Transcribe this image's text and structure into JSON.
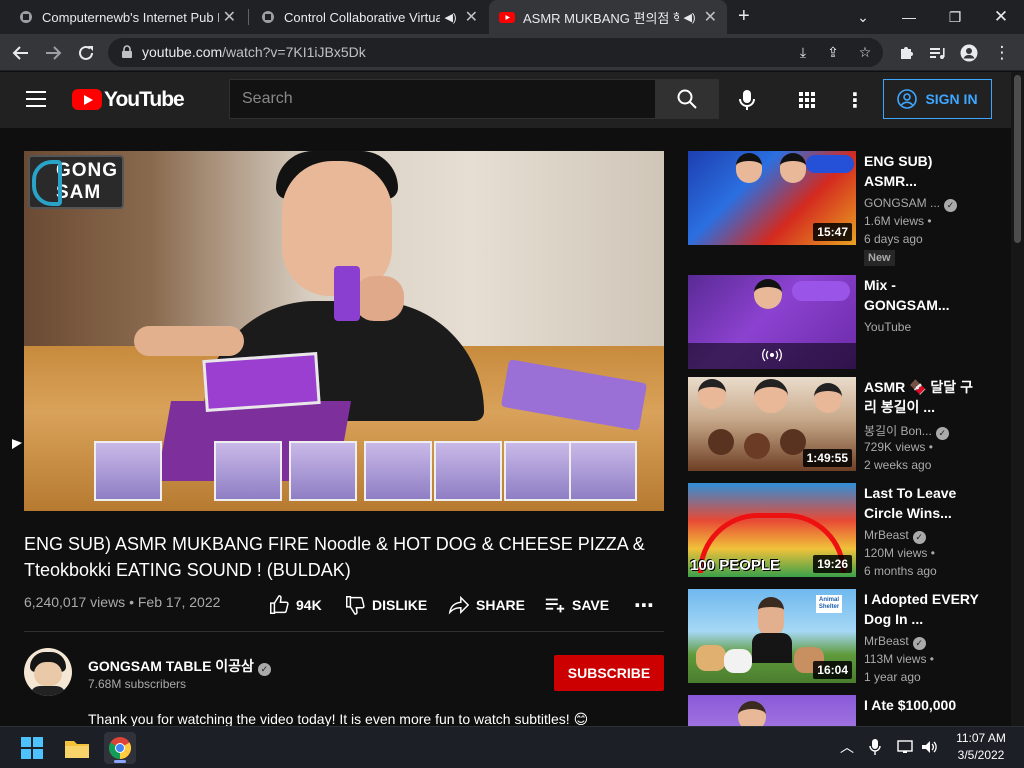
{
  "browser": {
    "tabs": [
      {
        "title": "Computernewb's Internet Pub H",
        "active": false
      },
      {
        "title": "Control Collaborative Virtual",
        "active": false
      },
      {
        "title": "ASMR MUKBANG 편의점 핵",
        "active": true
      }
    ],
    "url_domain": "youtube.com",
    "url_path": "/watch?v=7KI1iJBx5Dk"
  },
  "youtube": {
    "logo_text": "YouTube",
    "search_placeholder": "Search",
    "sign_in_label": "SIGN IN"
  },
  "video": {
    "overlay_logo": "GONG SAM",
    "title": "ENG SUB) ASMR MUKBANG FIRE Noodle & HOT DOG & CHEESE PIZZA & Tteokbokki EATING SOUND ! (BULDAK)",
    "views": "6,240,017 views",
    "date": "Feb 17, 2022",
    "likes": "94K",
    "dislike_label": "DISLIKE",
    "share_label": "SHARE",
    "save_label": "SAVE"
  },
  "channel": {
    "name": "GONGSAM TABLE 이공삼",
    "subscribers": "7.68M subscribers",
    "subscribe_label": "SUBSCRIBE",
    "description_line": "Thank you for watching the video today! It is even more fun to watch subtitles!"
  },
  "recommendations": [
    {
      "title": "ENG SUB) ASMR...",
      "channel": "GONGSAM ...",
      "verified": true,
      "views": "1.6M views",
      "age": "6 days ago",
      "duration": "15:47",
      "badge": "New"
    },
    {
      "title": "Mix - GONGSAM...",
      "channel": "YouTube",
      "verified": false,
      "views": "",
      "age": "",
      "duration": "",
      "badge": ""
    },
    {
      "title": "ASMR 🍫 달달 구리 봉길이 ...",
      "channel": "봉길이 Bon...",
      "verified": true,
      "views": "729K views",
      "age": "2 weeks ago",
      "duration": "1:49:55",
      "badge": ""
    },
    {
      "title": "Last To Leave Circle Wins...",
      "channel": "MrBeast",
      "verified": true,
      "views": "120M views",
      "age": "6 months ago",
      "duration": "19:26",
      "badge": ""
    },
    {
      "title": "I Adopted EVERY Dog In ...",
      "channel": "MrBeast",
      "verified": true,
      "views": "113M views",
      "age": "1 year ago",
      "duration": "16:04",
      "badge": ""
    },
    {
      "title": "I Ate $100,000",
      "channel": "",
      "verified": false,
      "views": "",
      "age": "",
      "duration": "",
      "badge": ""
    }
  ],
  "thumb_texts": {
    "circle_caption": "100 PEOPLE",
    "shelter_sign": "Animal Shelter"
  },
  "taskbar": {
    "time": "11:07 AM",
    "date": "3/5/2022"
  },
  "colors": {
    "accent_blue": "#3ea6ff",
    "subscribe_red": "#cc0000",
    "yt_red": "#ff0000"
  }
}
